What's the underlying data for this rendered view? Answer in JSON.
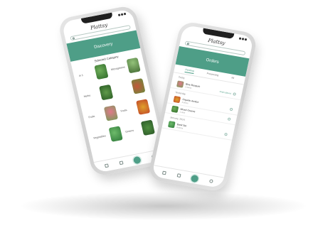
{
  "left_phone": {
    "logo": "Plattsy",
    "banner": "Discovery",
    "section_title": "Selected Category",
    "categories": [
      {
        "label": "In 1"
      },
      {
        "label": "Microgreens"
      },
      {
        "label": "Herbs"
      },
      {
        "label": ""
      },
      {
        "label": "Fruits"
      },
      {
        "label": "Fruits"
      },
      {
        "label": "Vegetables"
      },
      {
        "label": "Greens"
      }
    ]
  },
  "right_phone": {
    "logo": "Plattsy",
    "banner": "Orders",
    "tabs": [
      "Pending",
      "Processing",
      "All"
    ],
    "groups": [
      {
        "label": "Today",
        "orders": [
          {
            "name": "Blue Bouquet",
            "sub": "2 items",
            "status": "Order placed"
          }
        ]
      },
      {
        "label": "Yesterday",
        "orders": [
          {
            "name": "Organic Arctica",
            "sub": "3 items",
            "status": ""
          },
          {
            "name": "Mixed Greens",
            "sub": "1 item",
            "status": ""
          }
        ]
      },
      {
        "label": "January, 2024",
        "orders": [
          {
            "name": "Basil Set",
            "sub": "4 items",
            "status": ""
          }
        ]
      }
    ]
  },
  "icons": {
    "search": "search-icon",
    "home": "home-icon",
    "list": "list-icon",
    "cart": "cart-icon",
    "user": "user-icon"
  },
  "colors": {
    "accent": "#4e9e87",
    "phone_frame": "#d8d8d8"
  }
}
